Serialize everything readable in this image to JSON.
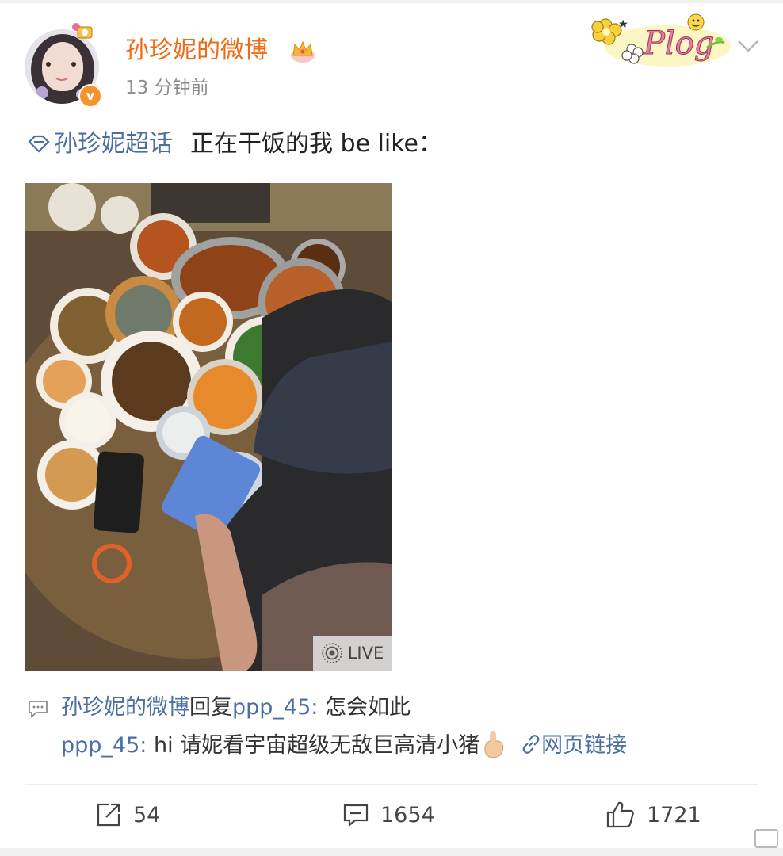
{
  "post": {
    "author": "孙珍妮的微博",
    "time": "13 分钟前",
    "topic": "孙珍妮超话",
    "text": "正在干饭的我 be like：",
    "live_label": "LIVE",
    "sticker_text": "Plog"
  },
  "comments": [
    {
      "user": "孙珍妮的微博",
      "reply_word": "回复",
      "reply_to": "ppp_45",
      "sep": ": ",
      "text": "怎会如此"
    },
    {
      "user": "ppp_45",
      "sep": ": ",
      "text": "hi 请妮看宇宙超级无敌巨高清小猪",
      "link": "网页链接"
    }
  ],
  "actions": {
    "repost_count": "54",
    "comment_count": "1654",
    "like_count": "1721"
  },
  "colors": {
    "author": "#f06b15",
    "link": "#4a6fa0",
    "verified": "#f7932b"
  },
  "icons": [
    "crown-icon",
    "topic-icon",
    "comment-icon",
    "link-icon",
    "repost-icon",
    "comment-bubble-icon",
    "like-icon",
    "live-icon",
    "chevron-down-icon"
  ]
}
